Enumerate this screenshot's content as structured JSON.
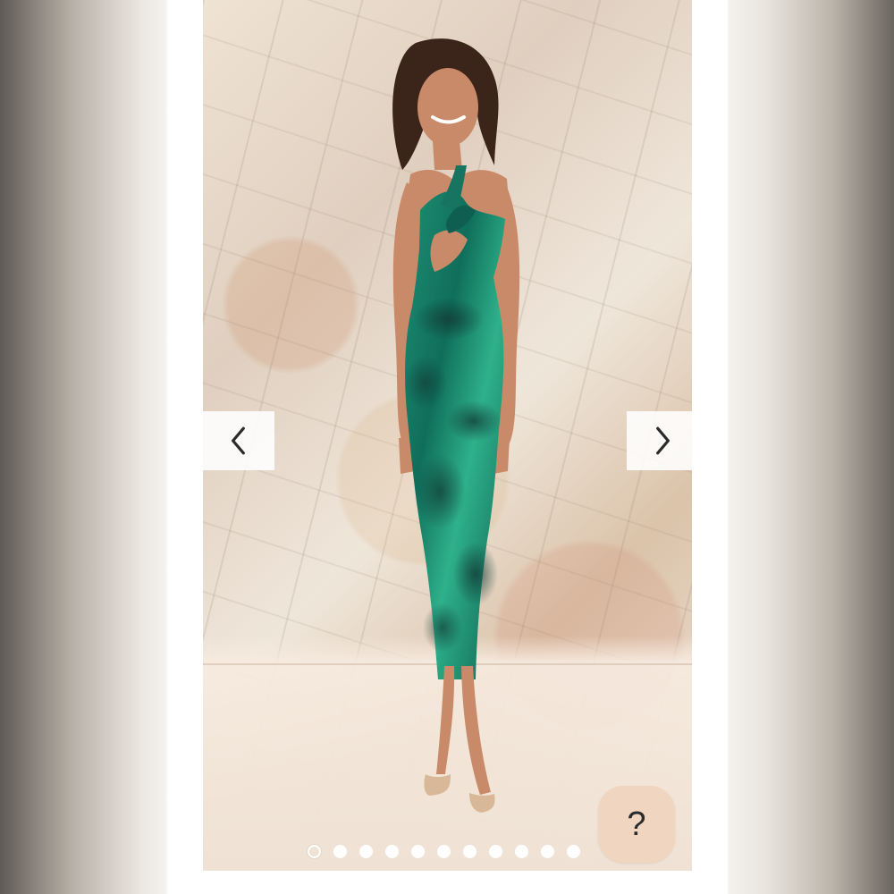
{
  "gallery": {
    "total_slides": 11,
    "active_slide": 1,
    "dots": [
      "",
      "",
      "",
      "",
      "",
      "",
      "",
      "",
      "",
      "",
      ""
    ]
  },
  "controls": {
    "prev_icon": "chevron-left-icon",
    "next_icon": "chevron-right-icon",
    "help_icon": "question-mark-icon",
    "help_label": "?"
  },
  "colors": {
    "help_button": "#f0d5c0",
    "icon_dark": "#2b2b2b"
  }
}
